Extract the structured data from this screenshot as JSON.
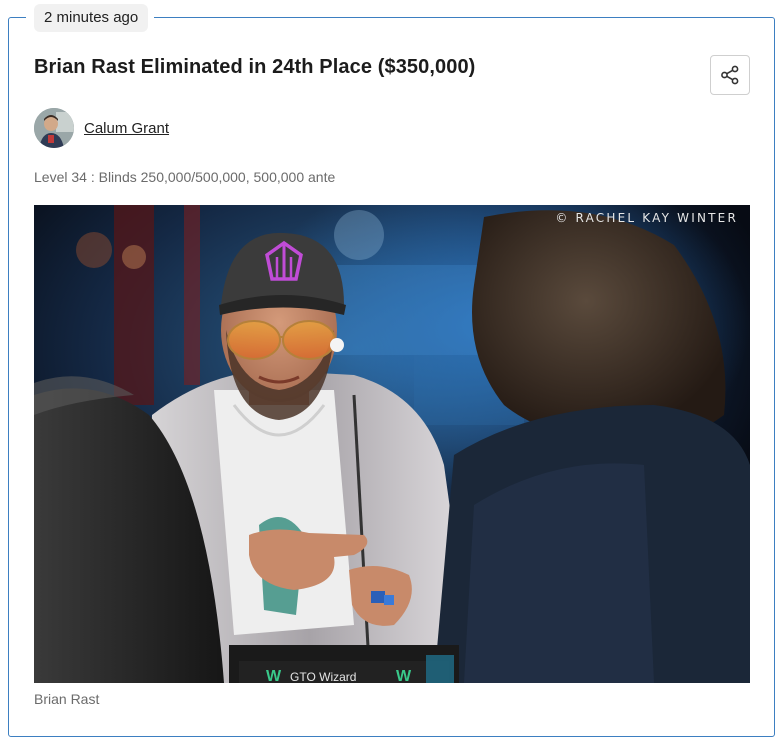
{
  "post": {
    "time_ago": "2 minutes ago",
    "title": "Brian Rast Eliminated in 24th Place ($350,000)",
    "author_name": "Calum Grant",
    "level_info": "Level 34 : Blinds 250,000/500,000, 500,000 ante",
    "photo_credit": "© RACHEL KAY WINTER",
    "photo_caption": "Brian Rast",
    "table_brand": "GTO Wizard"
  },
  "icons": {
    "share": "share-icon"
  },
  "colors": {
    "card_border": "#3d7fc1",
    "badge_bg": "#f1f1f1",
    "cap_logo": "#c04cd6"
  }
}
